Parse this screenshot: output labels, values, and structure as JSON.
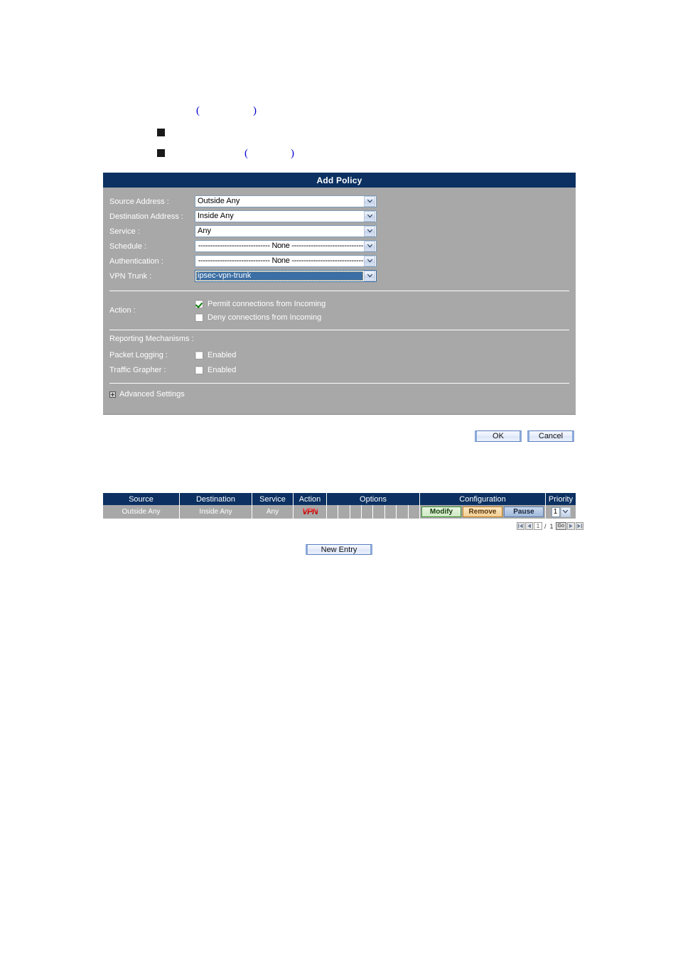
{
  "document": {
    "paren_line_1": "(                    )",
    "paren_line_2": "(                )",
    "bullet_1": "",
    "bullet_2": ""
  },
  "policy_form": {
    "title": "Add Policy",
    "fields": [
      {
        "label": "Source Address :",
        "value": "Outside Any",
        "focused": false
      },
      {
        "label": "Destination Address :",
        "value": "Inside Any",
        "focused": false
      },
      {
        "label": "Service :",
        "value": "Any",
        "focused": false
      },
      {
        "label": "Schedule :",
        "value": "------------------------------ None ------------------------------",
        "focused": false
      },
      {
        "label": "Authentication :",
        "value": "------------------------------ None ------------------------------",
        "focused": false
      },
      {
        "label": "VPN Trunk :",
        "value": "ipsec-vpn-trunk",
        "focused": true
      }
    ],
    "action": {
      "label": "Action :",
      "options": [
        {
          "label": "Permit connections from Incoming",
          "checked": true
        },
        {
          "label": "Deny connections from Incoming",
          "checked": false
        }
      ]
    },
    "reporting": {
      "title": "Reporting Mechanisms :",
      "rows": [
        {
          "label": "Packet Logging :",
          "check_label": "Enabled",
          "checked": false
        },
        {
          "label": "Traffic Grapher :",
          "check_label": "Enabled",
          "checked": false
        }
      ]
    },
    "advanced": {
      "label": "Advanced Settings",
      "icon": "plus-expander-icon"
    },
    "buttons": {
      "ok": "OK",
      "cancel": "Cancel"
    }
  },
  "policy_table": {
    "headers": [
      "Source",
      "Destination",
      "Service",
      "Action",
      "Options",
      "Configuration",
      "Priority"
    ],
    "options_cell_count": 8,
    "row": {
      "source": "Outside Any",
      "destination": "Inside Any",
      "service": "Any",
      "action_icon": "vpn-badge-icon",
      "action_text": "VPN",
      "configuration": [
        "Modify",
        "Remove",
        "Pause"
      ],
      "priority_value": "1"
    },
    "pager": {
      "first_icon": "first-page-icon",
      "prev_icon": "previous-page-icon",
      "current_page": "1",
      "separator": "/",
      "total_pages": "1",
      "go_label": "Go",
      "next_icon": "next-page-icon",
      "last_icon": "last-page-icon"
    },
    "new_entry_label": "New Entry"
  },
  "colors": {
    "titlebar": "#0b3061",
    "panel_bg": "#a8a8a8",
    "label_text": "#ffffff",
    "accent_blue": "#3a6ea5",
    "doc_text": "#0000cc",
    "modify_green": "#3b8f2f",
    "remove_orange": "#c8831c",
    "pause_blue": "#5f7fae",
    "vpn_red": "#d00000"
  }
}
